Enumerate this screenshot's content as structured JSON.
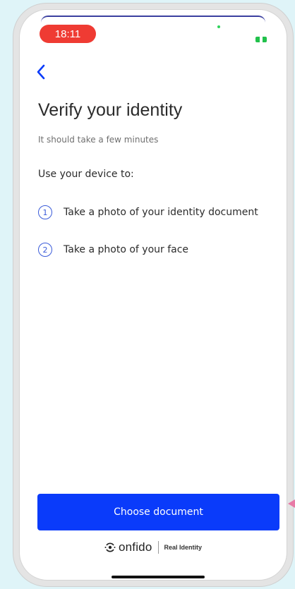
{
  "status_bar": {
    "time": "18:11"
  },
  "nav": {
    "back_icon": "chevron-left-icon"
  },
  "content": {
    "title": "Verify your identity",
    "subtitle": "It should take a few minutes",
    "intro": "Use your device to:",
    "steps": [
      {
        "number": "1",
        "text": "Take a photo of your identity document"
      },
      {
        "number": "2",
        "text": "Take a photo of your face"
      }
    ]
  },
  "actions": {
    "primary_label": "Choose document"
  },
  "footer": {
    "brand_name": "onfido",
    "tagline": "Real Identity"
  },
  "colors": {
    "accent": "#0a3bfa",
    "step_ring": "#3a5bd9",
    "time_pill": "#ef3b33",
    "battery": "#21c14b",
    "background": "#dff4f8",
    "arrow": "#e87aa6"
  }
}
